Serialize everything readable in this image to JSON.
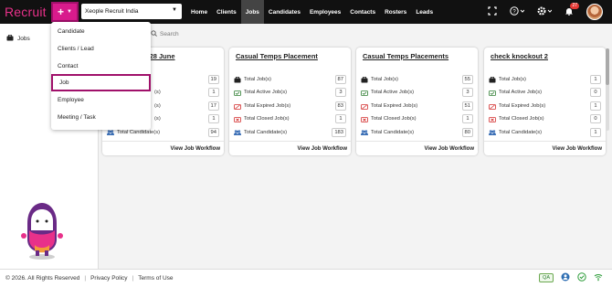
{
  "brand": {
    "logo_text": "Recruit"
  },
  "header": {
    "company": "Xeople Recruit India",
    "nav": [
      "Home",
      "Clients",
      "Jobs",
      "Candidates",
      "Employees",
      "Contacts",
      "Rosters",
      "Leads"
    ],
    "active_nav": "Jobs",
    "notification_count": "27",
    "icons": [
      "fullscreen-icon",
      "help-icon",
      "settings-icon",
      "bell-icon",
      "avatar"
    ]
  },
  "add_menu": {
    "items": [
      "Candidate",
      "Clients / Lead",
      "Contact",
      "Job",
      "Employee",
      "Meeting / Task"
    ],
    "highlighted": "Job"
  },
  "sidebar": {
    "jobs_label": "Jobs"
  },
  "search": {
    "placeholder": "Search"
  },
  "stat_labels": [
    "Total Job(s)",
    "Total Active Job(s)",
    "Total Expired Job(s)",
    "Total Closed Job(s)",
    "Total Candidate(s)"
  ],
  "cards": [
    {
      "title": "lyst - 28 June",
      "values": [
        "19",
        "1",
        "17",
        "1",
        "94"
      ],
      "footer": "View Job Workflow"
    },
    {
      "title": "Casual Temps Placement",
      "values": [
        "87",
        "3",
        "83",
        "1",
        "183"
      ],
      "footer": "View Job Workflow"
    },
    {
      "title": "Casual Temps Placements",
      "values": [
        "55",
        "3",
        "51",
        "1",
        "80"
      ],
      "footer": "View Job Workflow"
    },
    {
      "title": "check knockout 2",
      "values": [
        "1",
        "0",
        "1",
        "0",
        "1"
      ],
      "footer": "View Job Workflow"
    }
  ],
  "card_partial_labels": [
    "(s)",
    "(s)",
    "(s)",
    "Total Candidate(s)"
  ],
  "footer": {
    "copyright": "© 2026. All Rights Reserved",
    "privacy": "Privacy Policy",
    "terms": "Terms of Use",
    "qa": "QA"
  },
  "colors": {
    "accent": "#d81b8c",
    "topbar": "#111111",
    "highlight_border": "#a0106a"
  }
}
